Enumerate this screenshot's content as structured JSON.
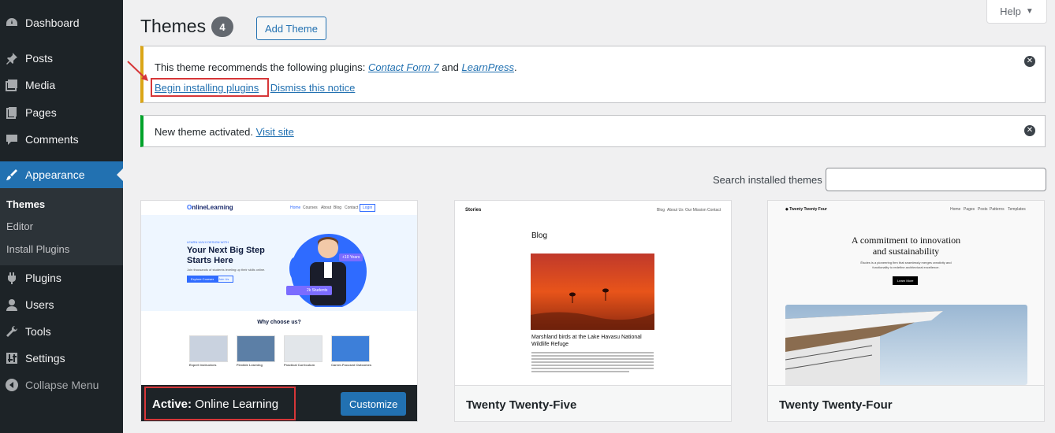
{
  "sidebar": {
    "items": [
      {
        "label": "Dashboard",
        "icon": "dashboard-icon"
      },
      {
        "label": "Posts",
        "icon": "pushpin-icon"
      },
      {
        "label": "Media",
        "icon": "media-icon"
      },
      {
        "label": "Pages",
        "icon": "pages-icon"
      },
      {
        "label": "Comments",
        "icon": "comment-icon"
      },
      {
        "label": "Appearance",
        "icon": "paintbrush-icon"
      },
      {
        "label": "Plugins",
        "icon": "plugin-icon"
      },
      {
        "label": "Users",
        "icon": "user-icon"
      },
      {
        "label": "Tools",
        "icon": "wrench-icon"
      },
      {
        "label": "Settings",
        "icon": "settings-icon"
      }
    ],
    "submenu": [
      "Themes",
      "Editor",
      "Install Plugins"
    ],
    "collapse_label": "Collapse Menu"
  },
  "header": {
    "title": "Themes",
    "count": "4",
    "add_theme_label": "Add Theme",
    "help_label": "Help"
  },
  "notices": {
    "plugins": {
      "text_prefix": "This theme recommends the following plugins:",
      "plugin1": "Contact Form 7",
      "and": "and",
      "plugin2": "LearnPress",
      "period": ".",
      "begin_link": "Begin installing plugins",
      "dismiss_link": "Dismiss this notice"
    },
    "activated": {
      "text": "New theme activated.",
      "visit_link": "Visit site"
    }
  },
  "search": {
    "label": "Search installed themes",
    "value": ""
  },
  "themes": [
    {
      "name": "Online Learning",
      "active_prefix": "Active:",
      "customize_label": "Customize",
      "preview": {
        "logo": "nlineLearning",
        "nav": [
          "Home",
          "Courses",
          "About",
          "Blog",
          "Contact",
          "Login"
        ],
        "eyebrow": "LEARN UI/UX DESIGN WITH",
        "headline1": "Your Next Big Step",
        "headline2": "Starts Here",
        "subline": "Join thousands of students leveling up their skills online.",
        "cta1": "Explore Courses",
        "cta2": "Join Us",
        "badge1": "+10 Years",
        "badge2": "2k Students",
        "section": "Why choose us?",
        "features": [
          "Expert Instructors",
          "Flexible Learning",
          "Practical Curriculum",
          "Career-Focused Outcomes"
        ]
      }
    },
    {
      "name": "Twenty Twenty-Five",
      "preview": {
        "site": "Stories",
        "nav": [
          "Blog",
          "About Us",
          "Our Mission",
          "Contact"
        ],
        "heading": "Blog",
        "caption": "Marshland birds at the Lake Havasu National Wildlife Refuge"
      }
    },
    {
      "name": "Twenty Twenty-Four",
      "preview": {
        "site": "Twenty Twenty Four",
        "nav": [
          "Home",
          "Pages",
          "Posts",
          "Patterns",
          "Templates"
        ],
        "headline1": "A commitment to innovation",
        "headline2": "and sustainability",
        "body": "Études is a pioneering firm that seamlessly merges creativity and functionality to redefine architectural excellence.",
        "button": "Learn More"
      }
    }
  ],
  "colors": {
    "sidebar_bg": "#1d2327",
    "accent": "#2271b1",
    "warning": "#dba617",
    "success": "#00a32a",
    "highlight": "#d63638"
  }
}
